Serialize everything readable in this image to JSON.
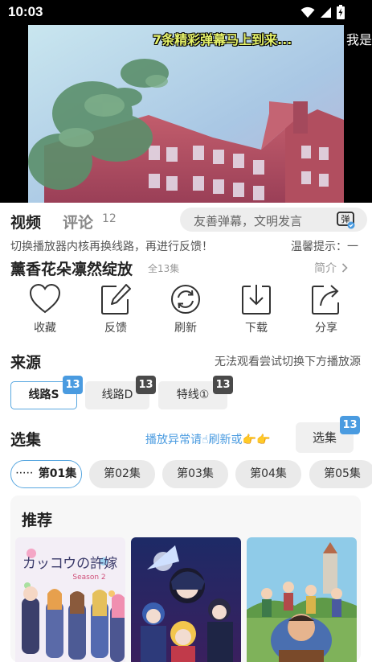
{
  "status_bar": {
    "time": "10:03"
  },
  "player": {
    "danmaku": [
      "7条精彩弹幕马上到来...",
      "我是"
    ]
  },
  "tabs": {
    "video": "视频",
    "comment": "评论",
    "comment_count": "12"
  },
  "danmaku_input": {
    "placeholder": "友善弹幕，文明发言",
    "button_icon": "danmaku-toggle-icon",
    "button_label": "弹"
  },
  "notice": {
    "scroll_text": "切换播放器内核再换线路，再进行反馈！",
    "tip": "温馨提示：一"
  },
  "anime": {
    "title": "薰香花朵凛然绽放",
    "episode_count": "全13集",
    "intro_label": "简介"
  },
  "actions": [
    {
      "label": "收藏",
      "icon": "heart-icon"
    },
    {
      "label": "反馈",
      "icon": "edit-icon"
    },
    {
      "label": "刷新",
      "icon": "refresh-icon"
    },
    {
      "label": "下载",
      "icon": "download-icon"
    },
    {
      "label": "分享",
      "icon": "share-icon"
    }
  ],
  "source": {
    "title": "来源",
    "hint": "无法观看尝试切换下方播放源",
    "routes": [
      {
        "label": "线路S",
        "count": "13",
        "active": true
      },
      {
        "label": "线路D",
        "count": "13",
        "active": false
      },
      {
        "label": "特线①",
        "count": "13",
        "active": false
      }
    ]
  },
  "episodes": {
    "title": "选集",
    "hint": "播放异常请☝刷新或👉👉",
    "select_label": "选集",
    "select_count": "13",
    "playing_indicator": "·····",
    "items": [
      "第01集",
      "第02集",
      "第03集",
      "第04集",
      "第05集"
    ]
  },
  "recommend": {
    "title": "推荐",
    "posters": [
      {
        "caption": "カッコウの許嫁",
        "subcaption": "Season 2"
      },
      {
        "caption": ""
      },
      {
        "caption": ""
      }
    ]
  },
  "colors": {
    "accent": "#4a9be0",
    "active_border": "#5aa8e0",
    "badge_dark": "#4a4a4a",
    "danmaku_yellow": "#e6f36a"
  }
}
